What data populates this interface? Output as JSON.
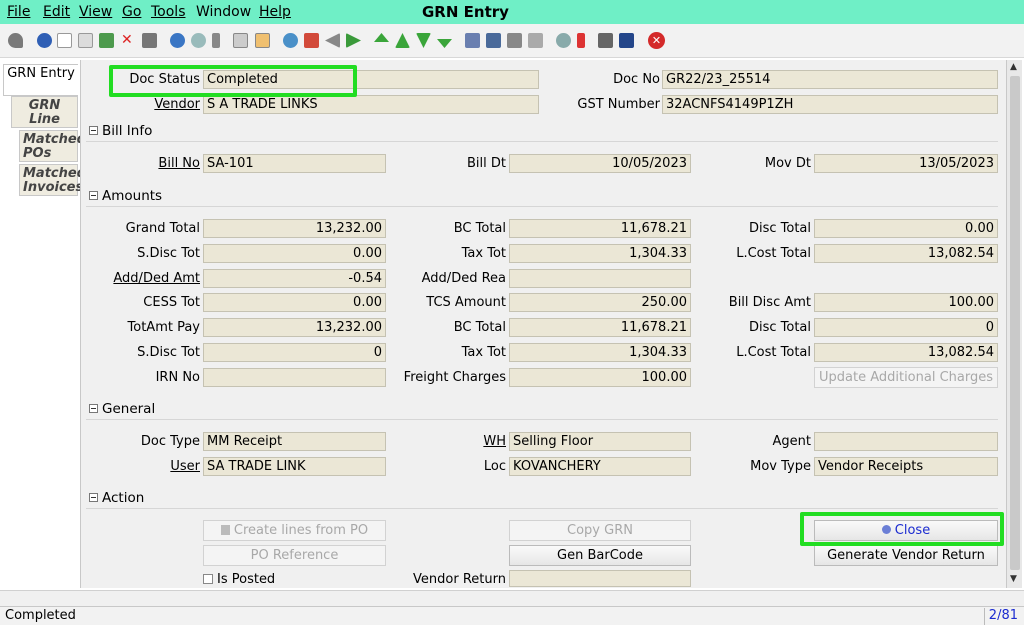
{
  "menu": [
    "File",
    "Edit",
    "View",
    "Go",
    "Tools",
    "Window",
    "Help"
  ],
  "window_title": "GRN Entry",
  "toolbar_icons": [
    "undo-icon",
    "help-icon",
    "new-icon",
    "copy-icon",
    "save-icon",
    "delete-icon",
    "print-preview-icon",
    "refresh-icon",
    "find-icon",
    "attachment-icon",
    "chat-icon",
    "report-icon",
    "history-icon",
    "home-icon",
    "back-icon",
    "forward-icon",
    "first-record-icon",
    "previous-record-icon",
    "next-record-icon",
    "last-record-icon",
    "report-icon-2",
    "archive-icon",
    "print-icon",
    "print-icon-2",
    "zoom-across-icon",
    "workflow-icon",
    "request-icon",
    "product-info-icon",
    "close-window-icon"
  ],
  "tabs": [
    "GRN Entry",
    "GRN Line",
    "Matched POs",
    "Matched Invoices"
  ],
  "header": {
    "doc_status_label": "Doc Status",
    "doc_status": "Completed",
    "doc_no_label": "Doc No",
    "doc_no": "GR22/23_25514",
    "vendor_label": "Vendor",
    "vendor": "S A TRADE LINKS",
    "gst_label": "GST Number",
    "gst": "32ACNFS4149P1ZH"
  },
  "bill_info": {
    "title": "Bill Info",
    "bill_no_label": "Bill No",
    "bill_no": "SA-101",
    "bill_dt_label": "Bill Dt",
    "bill_dt": "10/05/2023",
    "mov_dt_label": "Mov Dt",
    "mov_dt": "13/05/2023"
  },
  "amounts": {
    "title": "Amounts",
    "grand_total_label": "Grand Total",
    "grand_total": "13,232.00",
    "bc_total_label": "BC Total",
    "bc_total": "11,678.21",
    "disc_total_label": "Disc Total",
    "disc_total": "0.00",
    "s_disc_tot_label": "S.Disc Tot",
    "s_disc_tot": "0.00",
    "tax_tot_label": "Tax Tot",
    "tax_tot": "1,304.33",
    "l_cost_total_label": "L.Cost Total",
    "l_cost_total": "13,082.54",
    "add_ded_amt_label": "Add/Ded Amt",
    "add_ded_amt": "-0.54",
    "add_ded_rea_label": "Add/Ded Rea",
    "add_ded_rea": "",
    "cess_tot_label": "CESS Tot",
    "cess_tot": "0.00",
    "tcs_amount_label": "TCS Amount",
    "tcs_amount": "250.00",
    "bill_disc_amt_label": "Bill Disc Amt",
    "bill_disc_amt": "100.00",
    "tot_amt_pay_label": "TotAmt Pay",
    "tot_amt_pay": "13,232.00",
    "bc_total2_label": "BC Total",
    "bc_total2": "11,678.21",
    "disc_total2_label": "Disc Total",
    "disc_total2": "0",
    "s_disc_tot2_label": "S.Disc Tot",
    "s_disc_tot2": "0",
    "tax_tot2_label": "Tax Tot",
    "tax_tot2": "1,304.33",
    "l_cost_total2_label": "L.Cost Total",
    "l_cost_total2": "13,082.54",
    "irn_no_label": "IRN No",
    "irn_no": "",
    "freight_label": "Freight Charges",
    "freight": "100.00",
    "update_charges_button": "Update Additional Charges"
  },
  "general": {
    "title": "General",
    "doc_type_label": "Doc Type",
    "doc_type": "MM Receipt",
    "wh_label": "WH",
    "wh": "Selling Floor",
    "agent_label": "Agent",
    "agent": "",
    "user_label": "User",
    "user": "SA TRADE LINK",
    "loc_label": "Loc",
    "loc": "KOVANCHERY",
    "mov_type_label": "Mov Type",
    "mov_type": "Vendor Receipts"
  },
  "action": {
    "title": "Action",
    "create_lines_button": "Create lines from PO",
    "copy_grn_button": "Copy GRN",
    "close_button": "Close",
    "po_reference_button": "PO Reference",
    "gen_barcode_button": "Gen BarCode",
    "gen_vendor_return_button": "Generate Vendor Return",
    "is_posted_label": "Is Posted",
    "vendor_return_label": "Vendor Return",
    "vendor_return": ""
  },
  "status": {
    "message": "Completed",
    "record": "2/81"
  },
  "colors": {
    "menubar": "#6fefc6",
    "field_bg": "#ebe7d6",
    "highlight": "#22dd22",
    "link_blue": "#1b2bd0"
  }
}
